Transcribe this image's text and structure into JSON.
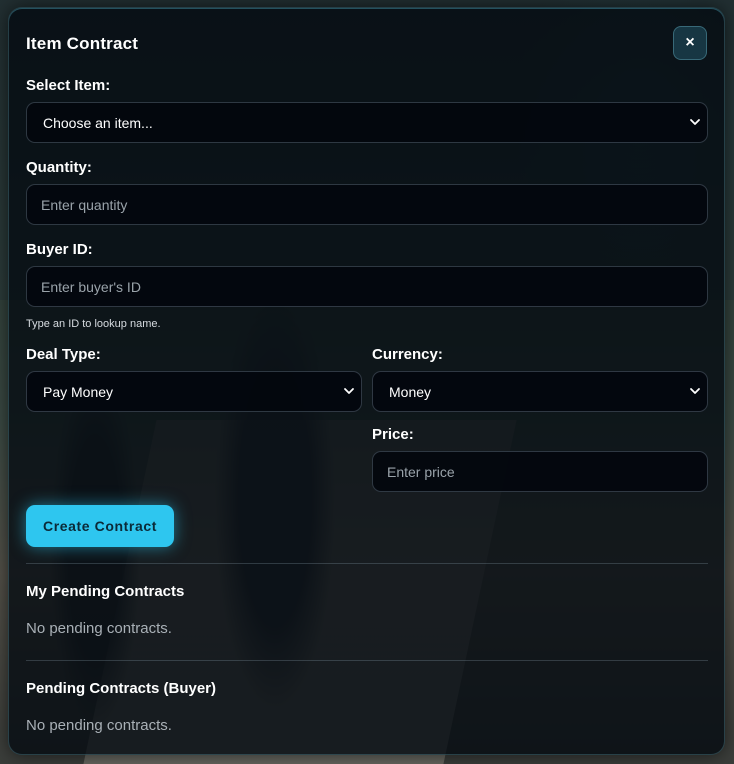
{
  "dialog": {
    "title": "Item Contract",
    "close_label": "×"
  },
  "form": {
    "item": {
      "label": "Select Item:",
      "selected": "Choose an item..."
    },
    "quantity": {
      "label": "Quantity:",
      "placeholder": "Enter quantity"
    },
    "buyer": {
      "label": "Buyer ID:",
      "placeholder": "Enter buyer's ID",
      "hint": "Type an ID to lookup name."
    },
    "deal_type": {
      "label": "Deal Type:",
      "selected": "Pay Money"
    },
    "currency": {
      "label": "Currency:",
      "selected": "Money"
    },
    "price": {
      "label": "Price:",
      "placeholder": "Enter price"
    },
    "submit_label": "Create Contract"
  },
  "sections": {
    "my_pending": {
      "title": "My Pending Contracts",
      "empty": "No pending contracts."
    },
    "buyer_pending": {
      "title": "Pending Contracts (Buyer)",
      "empty": "No pending contracts."
    }
  },
  "colors": {
    "accent": "#2ec6ef",
    "panel_bg": "#040a10"
  },
  "icons": {
    "close": "close-icon",
    "dropdown": "chevron-down-icon"
  }
}
